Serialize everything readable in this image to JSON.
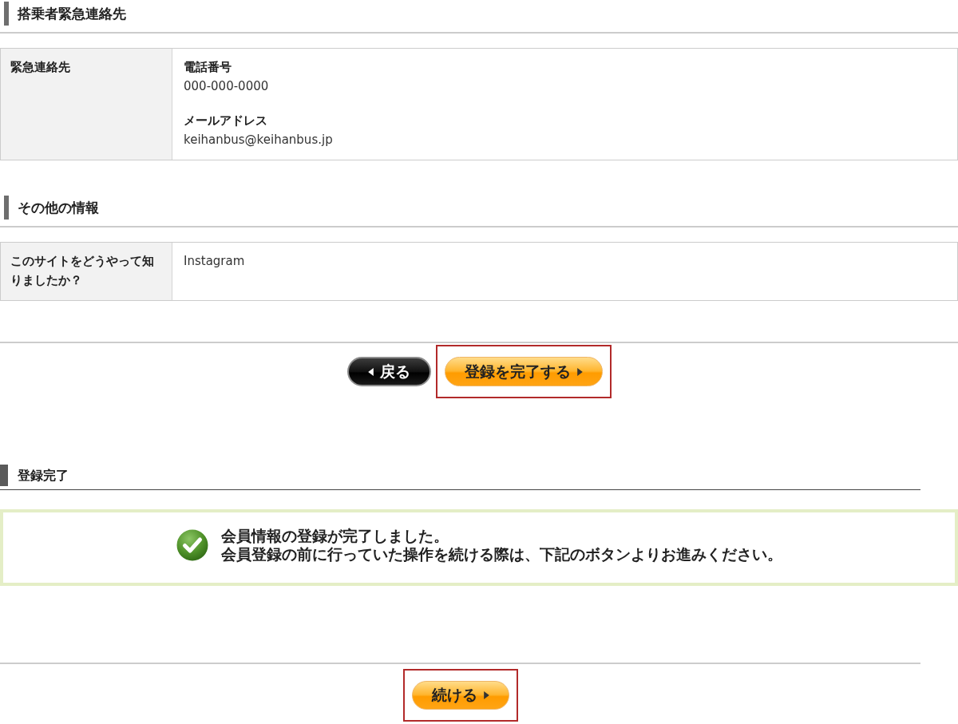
{
  "sections": [
    {
      "heading": "搭乗者緊急連絡先",
      "rows": [
        {
          "kind": "fields",
          "header": "緊急連絡先",
          "fields": [
            {
              "label": "電話番号",
              "value": "000-000-0000"
            },
            {
              "label": "メールアドレス",
              "value": "keihanbus@keihanbus.jp"
            }
          ]
        }
      ]
    },
    {
      "heading": "その他の情報",
      "rows": [
        {
          "kind": "text",
          "header": "このサイトをどうやって知りましたか？",
          "value": "Instagram"
        }
      ]
    }
  ],
  "form_buttons": [
    {
      "kind": "back",
      "label": "戻る",
      "highlighted": false
    },
    {
      "kind": "next",
      "label": "登録を完了する",
      "highlighted": true
    }
  ],
  "completion": {
    "heading": "登録完了",
    "message": [
      "会員情報の登録が完了しました。",
      "会員登録の前に行っていた操作を続ける際は、下記のボタンよりお進みください。"
    ],
    "buttons": [
      {
        "kind": "next",
        "label": "続ける",
        "highlighted": true
      }
    ]
  }
}
